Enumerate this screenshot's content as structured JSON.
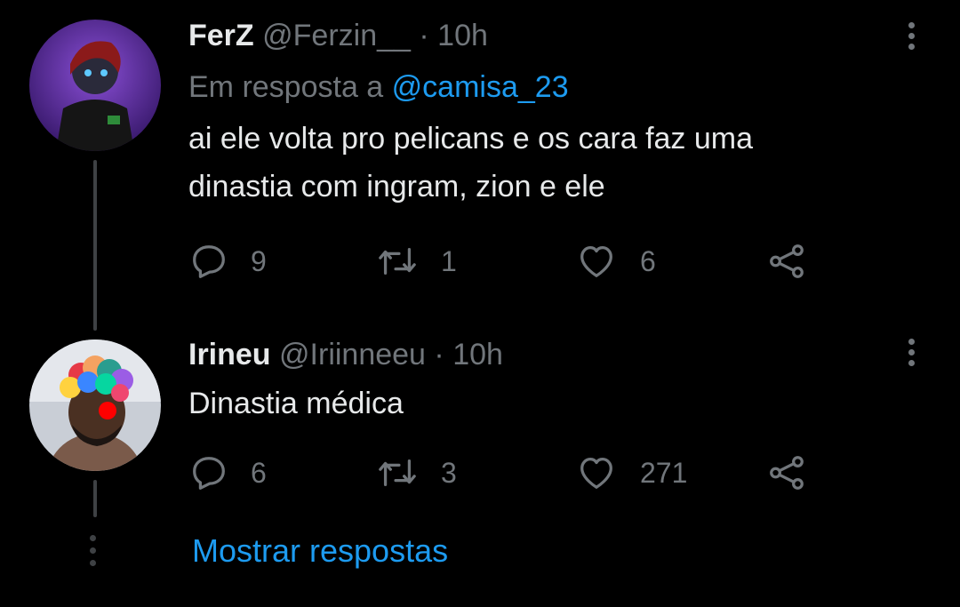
{
  "tweets": [
    {
      "display_name": "FerZ",
      "handle": "@Ferzin__",
      "time": "· 10h",
      "reply_prefix": "Em resposta a",
      "reply_to": "@camisa_23",
      "text_line1": "ai ele volta pro pelicans e os cara faz uma",
      "text_line2": "dinastia com ingram, zion e ele",
      "replies": "9",
      "retweets": "1",
      "likes": "6"
    },
    {
      "display_name": "Irineu",
      "handle": "@Iriinneeu",
      "time": "· 10h",
      "text_line1": "Dinastia médica",
      "replies": "6",
      "retweets": "3",
      "likes": "271"
    }
  ],
  "show_replies_label": "Mostrar respostas",
  "colors": {
    "background": "#000000",
    "text": "#e7e9ea",
    "muted": "#71767b",
    "link": "#1d9bf0",
    "thread_line": "#3e4144"
  }
}
